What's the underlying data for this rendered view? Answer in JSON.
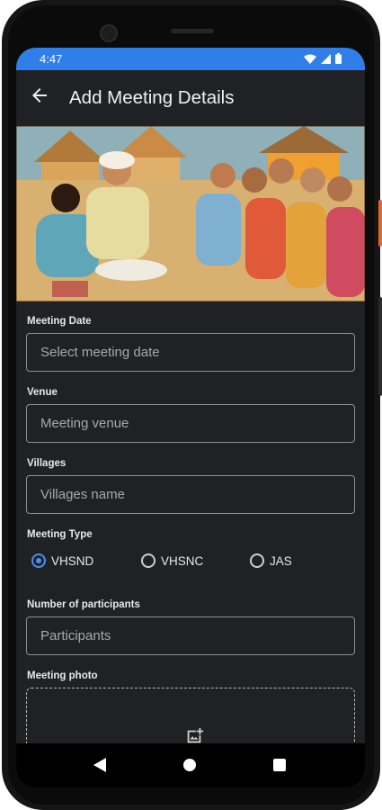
{
  "status_bar": {
    "time": "4:47",
    "icons": [
      "wifi-icon",
      "signal-icon",
      "battery-icon"
    ],
    "color": "#2f7ee9"
  },
  "app_bar": {
    "title": "Add Meeting Details",
    "back_icon": "arrow-back-icon"
  },
  "form": {
    "meeting_date": {
      "label": "Meeting Date",
      "placeholder": "Select meeting date",
      "value": ""
    },
    "venue": {
      "label": "Venue",
      "placeholder": "Meeting venue",
      "value": ""
    },
    "villages": {
      "label": "Villages",
      "placeholder": "Villages name",
      "value": ""
    },
    "meeting_type": {
      "label": "Meeting Type",
      "options": [
        {
          "label": "VHSND",
          "selected": true
        },
        {
          "label": "VHSNC",
          "selected": false
        },
        {
          "label": "JAS",
          "selected": false
        }
      ],
      "accent": "#4a8ff0"
    },
    "participants": {
      "label": "Number of participants",
      "placeholder": "Participants",
      "value": ""
    },
    "meeting_photo": {
      "label": "Meeting photo",
      "icon": "add-photo-icon"
    }
  },
  "nav_bar": {
    "buttons": [
      "back-triangle-icon",
      "home-circle-icon",
      "recents-square-icon"
    ]
  }
}
